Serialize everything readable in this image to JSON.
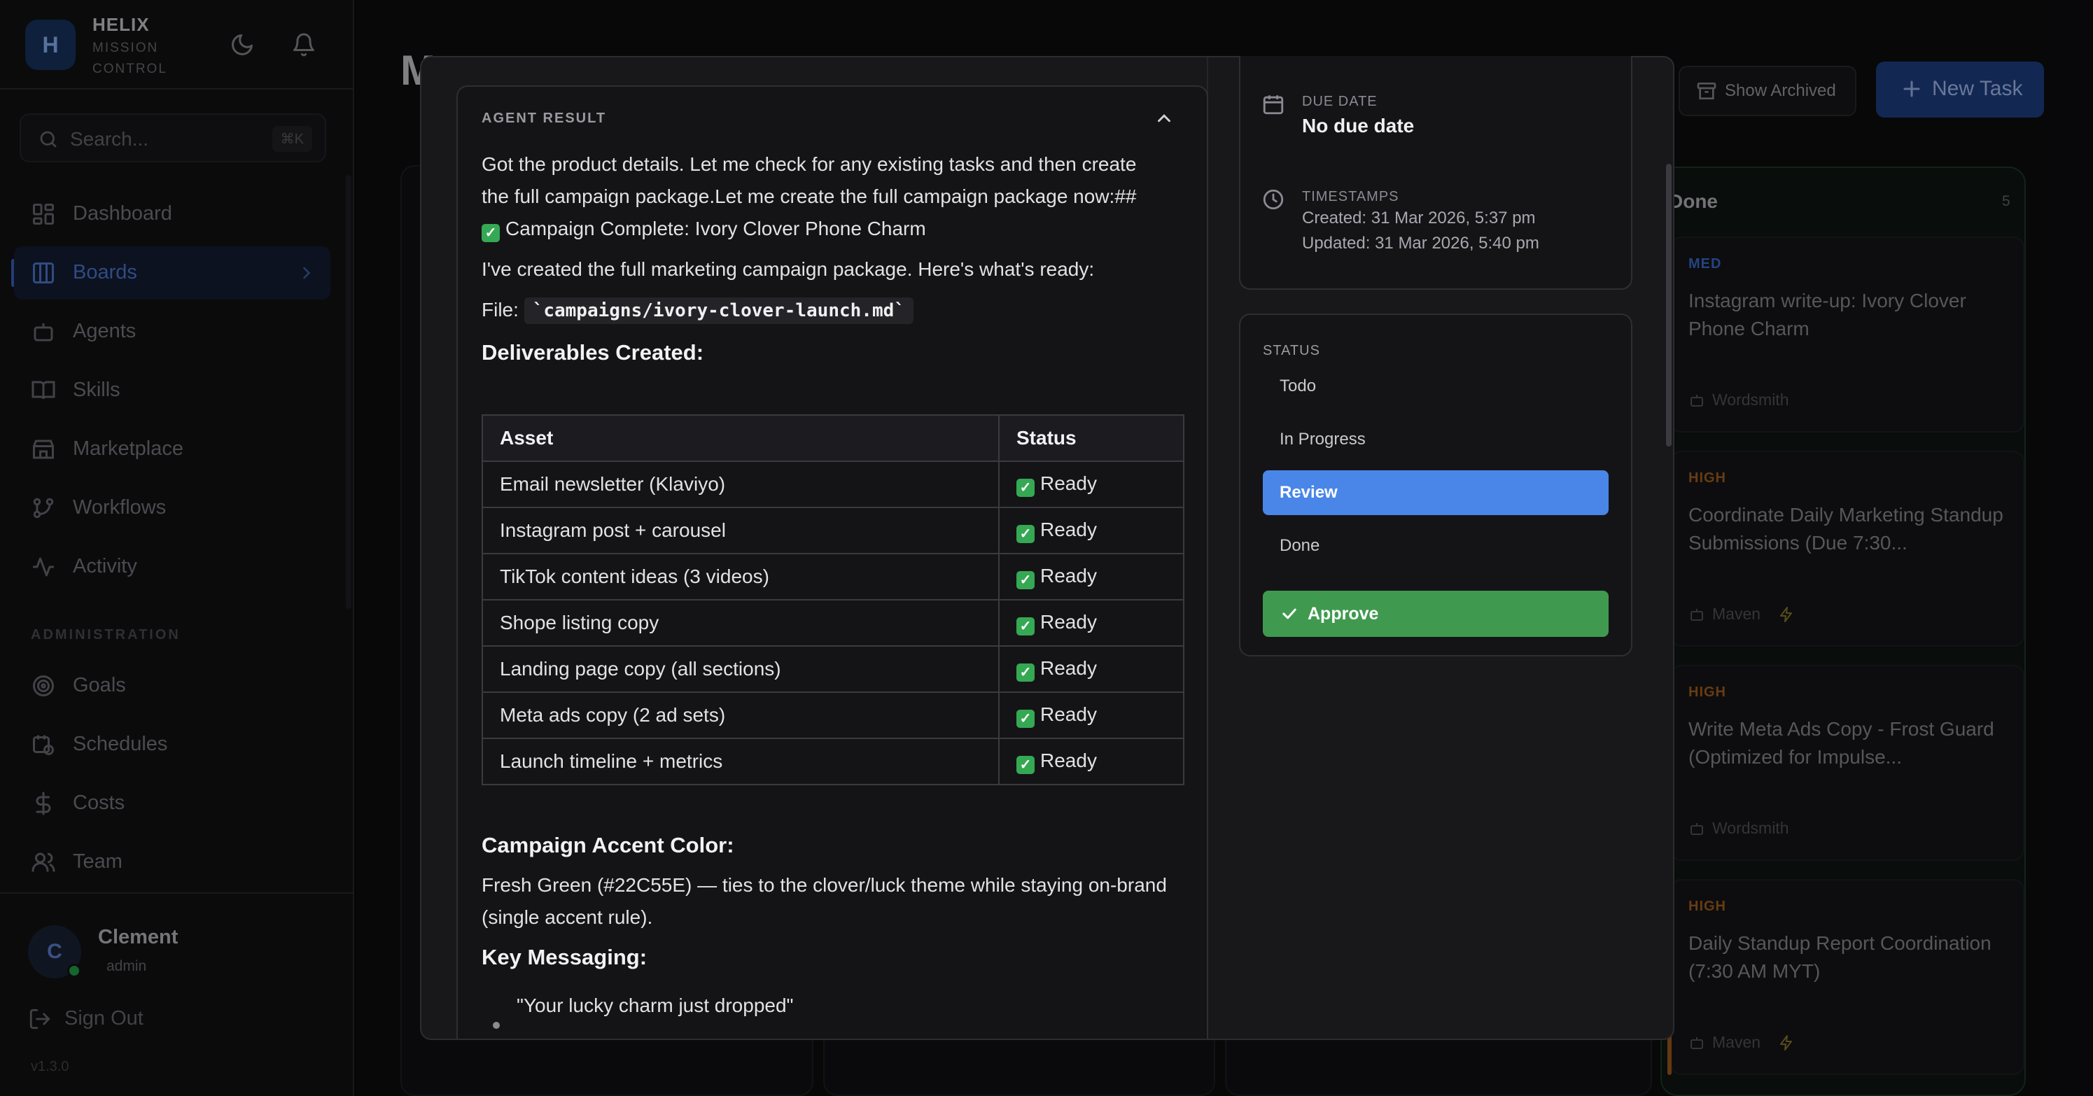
{
  "sidebar": {
    "brand": {
      "logo_letter": "H",
      "name": "HELIX",
      "subtitle": "MISSION CONTROL"
    },
    "search": {
      "placeholder": "Search...",
      "shortcut": "⌘K"
    },
    "nav": [
      {
        "label": "Dashboard",
        "icon": "grid-icon"
      },
      {
        "label": "Boards",
        "icon": "board-icon",
        "active": true
      },
      {
        "label": "Agents",
        "icon": "robot-icon"
      },
      {
        "label": "Skills",
        "icon": "book-icon"
      },
      {
        "label": "Marketplace",
        "icon": "store-icon"
      },
      {
        "label": "Workflows",
        "icon": "git-branch-icon"
      },
      {
        "label": "Activity",
        "icon": "pulse-icon"
      }
    ],
    "admin_section_label": "ADMINISTRATION",
    "admin_nav": [
      {
        "label": "Goals",
        "icon": "target-icon"
      },
      {
        "label": "Schedules",
        "icon": "calendar-clock-icon"
      },
      {
        "label": "Costs",
        "icon": "dollar-icon"
      },
      {
        "label": "Team",
        "icon": "users-icon"
      }
    ],
    "user": {
      "initial": "C",
      "name": "Clement",
      "role": "admin"
    },
    "sign_out": "Sign Out",
    "version": "v1.3.0"
  },
  "board": {
    "title": "M",
    "show_archived": "Show Archived",
    "new_task": "New Task",
    "done_column": {
      "title": "Done",
      "count": "5",
      "cards": [
        {
          "priority": "MED",
          "priority_color": "#3b6fd1",
          "title": "Instagram write-up: Ivory Clover Phone Charm",
          "agent": "Wordsmith",
          "bolt": false
        },
        {
          "priority": "HIGH",
          "priority_color": "#a8611d",
          "title": "Coordinate Daily Marketing Standup Submissions (Due 7:30...",
          "agent": "Maven",
          "bolt": true
        },
        {
          "priority": "HIGH",
          "priority_color": "#a8611d",
          "title": "Write Meta Ads Copy - Frost Guard (Optimized for Impulse...",
          "agent": "Wordsmith",
          "bolt": false
        },
        {
          "priority": "HIGH",
          "priority_color": "#a8611d",
          "title": "Daily Standup Report Coordination (7:30 AM MYT)",
          "agent": "Maven",
          "bolt": true
        }
      ]
    }
  },
  "modal": {
    "agent_result": {
      "label": "AGENT RESULT",
      "intro": "Got the product details. Let me check for any existing tasks and then create the full campaign package.Let me create the full campaign package now:##",
      "complete_line": "Campaign Complete: Ivory Clover Phone Charm",
      "summary": "I've created the full marketing campaign package. Here's what's ready:",
      "file_label": "File:",
      "file_path": "`campaigns/ivory-clover-launch.md`",
      "deliverables_heading": "Deliverables Created:",
      "table": {
        "headers": [
          "Asset",
          "Status"
        ],
        "rows": [
          [
            "Email newsletter (Klaviyo)",
            "Ready"
          ],
          [
            "Instagram post + carousel",
            "Ready"
          ],
          [
            "TikTok content ideas (3 videos)",
            "Ready"
          ],
          [
            "Shope listing copy",
            "Ready"
          ],
          [
            "Landing page copy (all sections)",
            "Ready"
          ],
          [
            "Meta ads copy (2 ad sets)",
            "Ready"
          ],
          [
            "Launch timeline + metrics",
            "Ready"
          ]
        ]
      },
      "accent_heading": "Campaign Accent Color:",
      "accent_text": "Fresh Green (#22C55E) — ties to the clover/luck theme while staying on-brand (single accent rule).",
      "messaging_heading": "Key Messaging:",
      "messaging_items": [
        "\"Your lucky charm just dropped\""
      ]
    },
    "details": {
      "due_date_label": "DUE DATE",
      "due_date_value": "No due date",
      "timestamps_label": "TIMESTAMPS",
      "created": "Created: 31 Mar 2026, 5:37 pm",
      "updated": "Updated: 31 Mar 2026, 5:40 pm"
    },
    "status": {
      "label": "STATUS",
      "options": [
        "Todo",
        "In Progress",
        "Review",
        "Done"
      ],
      "selected": "Review",
      "approve": "Approve"
    }
  },
  "colors": {
    "accent": "#4a86e8",
    "approve": "#3f9a4f",
    "check": "#35a853"
  }
}
